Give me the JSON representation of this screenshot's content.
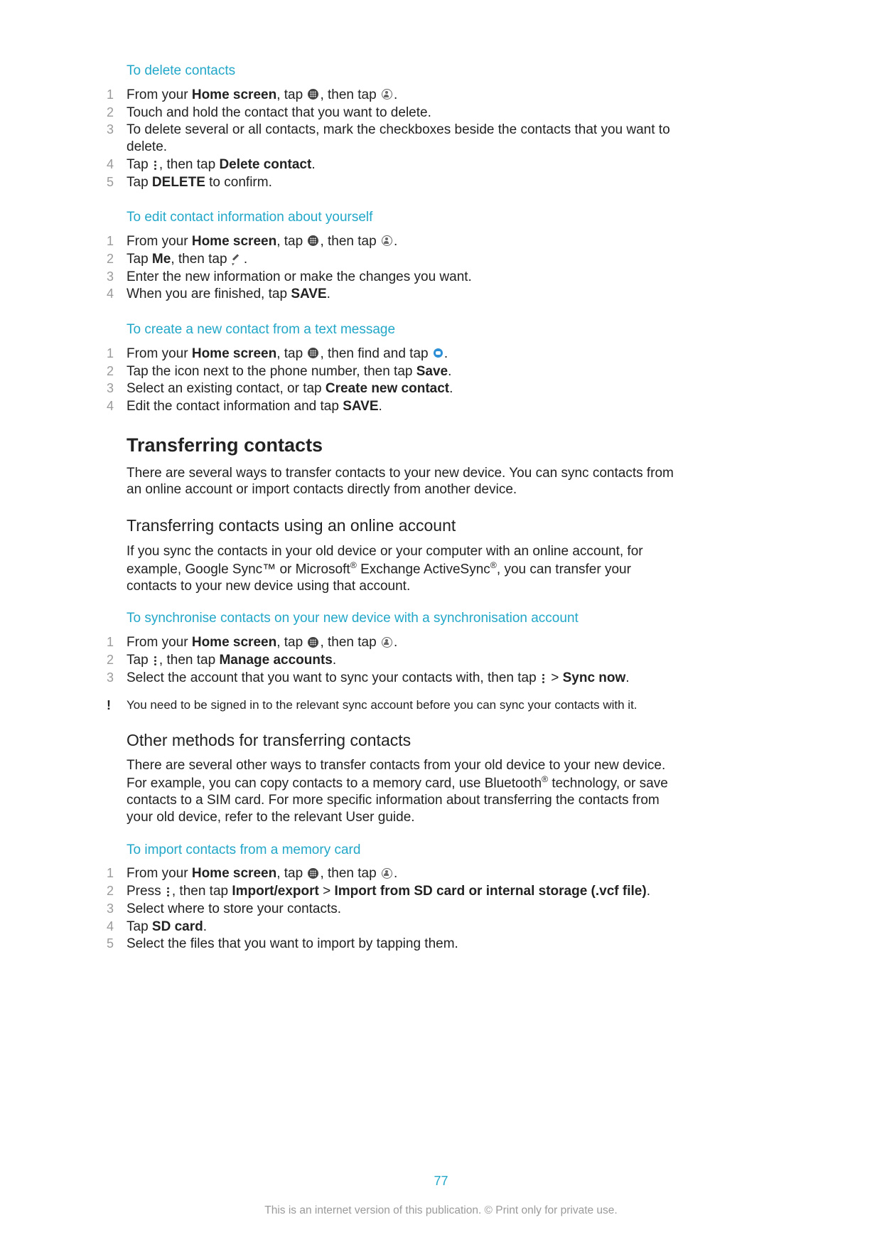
{
  "sections": {
    "s1": {
      "title": "To delete contacts",
      "steps": [
        {
          "n": "1",
          "pre": "From your ",
          "b1": "Home screen",
          "mid": ", tap ",
          "icon1": "apps",
          "mid2": ", then tap ",
          "icon2": "contacts",
          "post": "."
        },
        {
          "n": "2",
          "text": "Touch and hold the contact that you want to delete."
        },
        {
          "n": "3",
          "text": "To delete several or all contacts, mark the checkboxes beside the contacts that you want to delete."
        },
        {
          "n": "4",
          "pre": "Tap ",
          "icon1": "dots",
          "mid": ", then tap ",
          "b1": "Delete contact",
          "post": "."
        },
        {
          "n": "5",
          "pre": "Tap ",
          "b1": "DELETE",
          "post": " to confirm."
        }
      ]
    },
    "s2": {
      "title": "To edit contact information about yourself",
      "steps": [
        {
          "n": "1",
          "pre": "From your ",
          "b1": "Home screen",
          "mid": ", tap ",
          "icon1": "apps",
          "mid2": ", then tap ",
          "icon2": "contacts",
          "post": "."
        },
        {
          "n": "2",
          "pre": "Tap ",
          "b1": "Me",
          "mid": ", then tap ",
          "icon1": "pencil",
          "post": "."
        },
        {
          "n": "3",
          "text": "Enter the new information or make the changes you want."
        },
        {
          "n": "4",
          "pre": "When you are finished, tap ",
          "b1": "SAVE",
          "post": "."
        }
      ]
    },
    "s3": {
      "title": "To create a new contact from a text message",
      "steps": [
        {
          "n": "1",
          "pre": "From your ",
          "b1": "Home screen",
          "mid": ", tap ",
          "icon1": "apps",
          "mid2": ", then find and tap ",
          "icon2": "msg",
          "post": "."
        },
        {
          "n": "2",
          "pre": "Tap the icon next to the phone number, then tap ",
          "b1": "Save",
          "post": "."
        },
        {
          "n": "3",
          "pre": "Select an existing contact, or tap ",
          "b1": "Create new contact",
          "post": "."
        },
        {
          "n": "4",
          "pre": "Edit the contact information and tap ",
          "b1": "SAVE",
          "post": "."
        }
      ]
    },
    "h1": "Transferring contacts",
    "p1": "There are several ways to transfer contacts to your new device. You can sync contacts from an online account or import contacts directly from another device.",
    "h2a": "Transferring contacts using an online account",
    "p2_pre": "If you sync the contacts in your old device or your computer with an online account, for example, Google Sync™ or Microsoft",
    "p2_sup1": "®",
    "p2_mid": " Exchange ActiveSync",
    "p2_sup2": "®",
    "p2_post": ", you can transfer your contacts to your new device using that account.",
    "s4": {
      "title": "To synchronise contacts on your new device with a synchronisation account",
      "steps": [
        {
          "n": "1",
          "pre": "From your ",
          "b1": "Home screen",
          "mid": ", tap ",
          "icon1": "apps",
          "mid2": ", then tap ",
          "icon2": "contacts",
          "post": "."
        },
        {
          "n": "2",
          "pre": "Tap ",
          "icon1": "dots",
          "mid": ", then tap ",
          "b1": "Manage accounts",
          "post": "."
        },
        {
          "n": "3",
          "pre": "Select the account that you want to sync your contacts with, then tap ",
          "icon1": "dots",
          "mid": " > ",
          "b1": "Sync now",
          "post": "."
        }
      ],
      "note": "You need to be signed in to the relevant sync account before you can sync your contacts with it."
    },
    "h2b": "Other methods for transferring contacts",
    "p3_pre": "There are several other ways to transfer contacts from your old device to your new device. For example, you can copy contacts to a memory card, use Bluetooth",
    "p3_sup": "®",
    "p3_post": " technology, or save contacts to a SIM card. For more specific information about transferring the contacts from your old device, refer to the relevant User guide.",
    "s5": {
      "title": "To import contacts from a memory card",
      "steps": [
        {
          "n": "1",
          "pre": "From your ",
          "b1": "Home screen",
          "mid": ", tap ",
          "icon1": "apps",
          "mid2": ", then tap ",
          "icon2": "contacts",
          "post": "."
        },
        {
          "n": "2",
          "pre": "Press ",
          "icon1": "dots",
          "mid": ", then tap ",
          "b1": "Import/export",
          "mid2": " > ",
          "b2": "Import from SD card or internal storage (.vcf file)",
          "post": "."
        },
        {
          "n": "3",
          "text": "Select where to store your contacts."
        },
        {
          "n": "4",
          "pre": "Tap ",
          "b1": "SD card",
          "post": "."
        },
        {
          "n": "5",
          "text": "Select the files that you want to import by tapping them."
        }
      ]
    }
  },
  "pagenum": "77",
  "footer": "This is an internet version of this publication. © Print only for private use."
}
